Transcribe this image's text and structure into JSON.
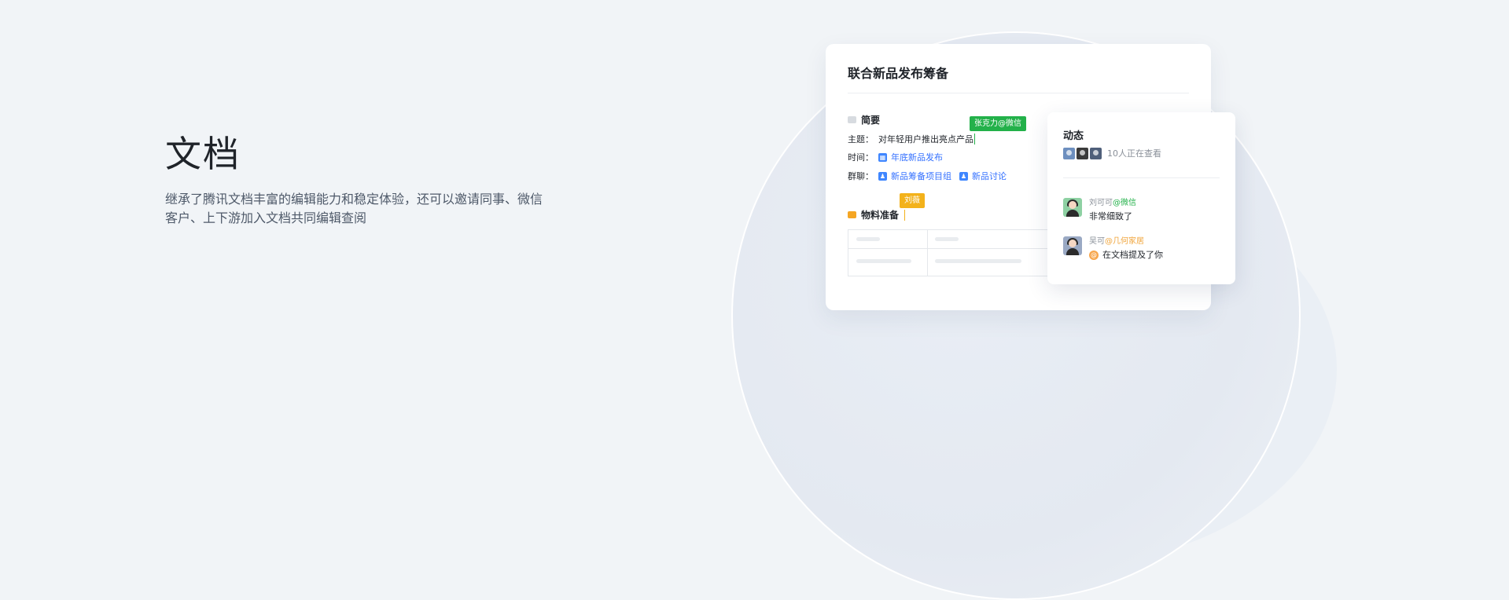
{
  "hero": {
    "title": "文档",
    "description_line1": "继承了腾讯文档丰富的编辑能力和稳定体验，还可以邀请同事、微信",
    "description_line2": "客户、上下游加入文档共同编辑查阅"
  },
  "doc": {
    "title": "联合新品发布筹备",
    "summary_section": {
      "heading": "简要",
      "subject_label": "主题：",
      "subject_value": "对年轻用户推出亮点产品",
      "time_label": "时间：",
      "time_link": "年底新品发布",
      "group_label": "群聊：",
      "group_links": [
        "新品筹备项目组",
        "新品讨论"
      ]
    },
    "materials_section": {
      "heading": "物料准备"
    },
    "cursor_tags": {
      "editor1": "张克力@微信",
      "editor2": "刘薇"
    }
  },
  "activity": {
    "title": "动态",
    "viewers_text": "10人正在查看",
    "items": [
      {
        "name": "刘可可",
        "org": "@微信",
        "message": "非常细致了"
      },
      {
        "name": "吴可",
        "org": "@几何家居",
        "message": "在文档提及了你",
        "badge": "@"
      }
    ]
  },
  "colors": {
    "accent_blue": "#3370ff",
    "tag_green": "#23b14a",
    "tag_amber": "#f3b21b",
    "org_orange": "#f0a43a"
  },
  "icons": [
    "summary-icon",
    "calendar-icon",
    "group-icon",
    "materials-icon",
    "mention-icon"
  ]
}
